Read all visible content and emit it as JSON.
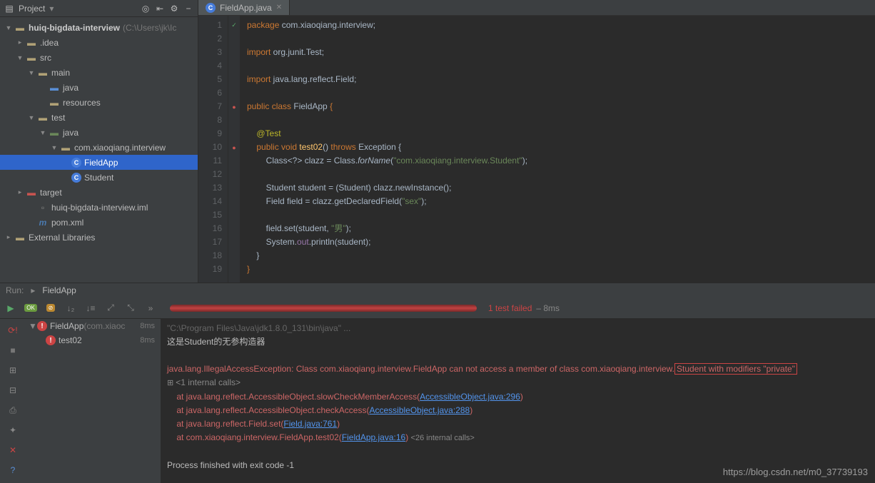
{
  "project_header": {
    "title": "Project"
  },
  "tree": {
    "root": {
      "name": "huiq-bigdata-interview",
      "hint": "(C:\\Users\\jk\\Ic"
    },
    "idea": ".idea",
    "src": "src",
    "main": "main",
    "main_java": "java",
    "main_resources": "resources",
    "test": "test",
    "test_java": "java",
    "pkg": "com.xiaoqiang.interview",
    "fieldapp": "FieldApp",
    "student": "Student",
    "target": "target",
    "iml": "huiq-bigdata-interview.iml",
    "pom": "pom.xml",
    "ext": "External Libraries"
  },
  "tab": {
    "file": "FieldApp.java"
  },
  "run": {
    "header_run": "Run:",
    "header_app": "FieldApp",
    "status": "1 test failed",
    "time_total": " – 8ms",
    "test_class": "FieldApp",
    "test_class_hint": " (com.xiaoc",
    "test_class_time": "8ms",
    "test_method": "test02",
    "test_method_time": "8ms"
  },
  "console": {
    "cmd": "\"C:\\Program Files\\Java\\jdk1.8.0_131\\bin\\java\" ...",
    "out1": "这是Student的无参构造器",
    "err_pre": "java.lang.IllegalAccessException: Class com.xiaoqiang.interview.FieldApp can not access a member of class com.xiaoqiang.interview.",
    "err_box": "Student with modifiers \"private\"",
    "int1": "<1 internal calls>",
    "st1_pre": "at java.lang.reflect.AccessibleObject.slowCheckMemberAccess(",
    "st1_link": "AccessibleObject.java:296",
    "st2_pre": "at java.lang.reflect.AccessibleObject.checkAccess(",
    "st2_link": "AccessibleObject.java:288",
    "st3_pre": "at java.lang.reflect.Field.set(",
    "st3_link": "Field.java:761",
    "st4_pre": "at com.xiaoqiang.interview.FieldApp.test02(",
    "st4_link": "FieldApp.java:16",
    "int2": "<26 internal calls>",
    "exit": "Process finished with exit code -1"
  },
  "watermark": "https://blog.csdn.net/m0_37739193"
}
